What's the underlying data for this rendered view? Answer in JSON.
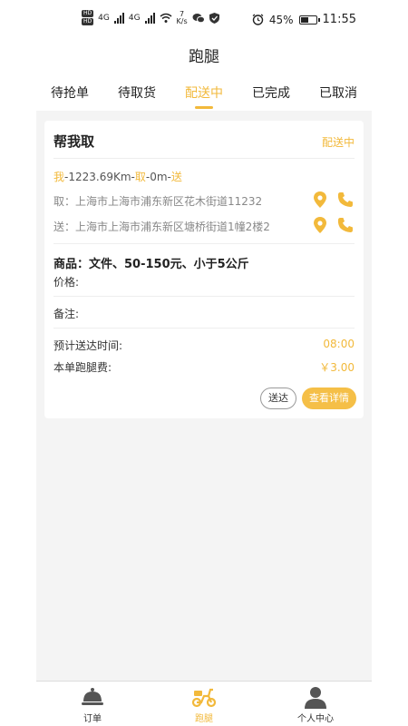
{
  "status_bar": {
    "network": "4G",
    "speed_value": "7",
    "speed_unit": "K/s",
    "battery": "45%",
    "time": "11:55"
  },
  "title": "跑腿",
  "tabs": [
    {
      "label": "待抢单",
      "active": false
    },
    {
      "label": "待取货",
      "active": false
    },
    {
      "label": "配送中",
      "active": true
    },
    {
      "label": "已完成",
      "active": false
    },
    {
      "label": "已取消",
      "active": false
    }
  ],
  "order": {
    "type": "帮我取",
    "status": "配送中",
    "route": {
      "me": "我",
      "dist1": "-1223.69Km-",
      "pick": "取",
      "dist2": "-0m-",
      "send": "送"
    },
    "pickup_address": "取：上海市上海市浦东新区花木街道11232",
    "delivery_address": "送：上海市上海市浦东新区塘桥街道1幢2楼2",
    "goods": "商品：文件、50-150元、小于5公斤",
    "price_label": "价格:",
    "note_label": "备注:",
    "eta_label": "预计送达时间:",
    "eta_value": "08:00",
    "fee_label": "本单跑腿费:",
    "fee_value": "￥3.00",
    "btn_send": "送达",
    "btn_detail": "查看详情"
  },
  "bottom_nav": [
    {
      "label": "订单",
      "icon": "bell-icon"
    },
    {
      "label": "跑腿",
      "icon": "scooter-icon"
    },
    {
      "label": "个人中心",
      "icon": "user-icon"
    }
  ],
  "colors": {
    "accent": "#f2b93b",
    "background": "#f4f4f4"
  }
}
